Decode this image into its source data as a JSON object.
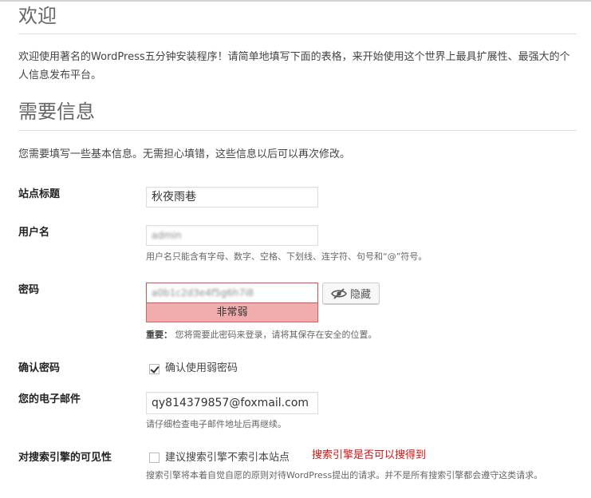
{
  "welcome": {
    "title": "欢迎",
    "text": "欢迎使用著名的WordPress五分钟安装程序！请简单地填写下面的表格，来开始使用这个世界上最具扩展性、最强大的个人信息发布平台。"
  },
  "info": {
    "title": "需要信息",
    "desc": "您需要填写一些基本信息。无需担心填错，这些信息以后可以再次修改。"
  },
  "fields": {
    "site_title": {
      "label": "站点标题",
      "value": "秋夜雨巷"
    },
    "username": {
      "label": "用户名",
      "value": "admin",
      "hint": "用户名只能含有字母、数字、空格、下划线、连字符、句号和“@”符号。"
    },
    "password": {
      "label": "密码",
      "value": "a0b1c2d3e4f5g6h7i8",
      "strength": "非常弱",
      "hide_label": "隐藏",
      "hint_bold": "重要：",
      "hint": "您将需要此密码来登录，请将其保存在安全的位置。"
    },
    "confirm": {
      "label": "确认密码",
      "checkbox_label": "确认使用弱密码",
      "checked": true
    },
    "email": {
      "label": "您的电子邮件",
      "value": "qy814379857@foxmail.com",
      "hint": "请仔细检查电子邮件地址后再继续。"
    },
    "search": {
      "label": "对搜索引擎的可见性",
      "checkbox_label": "建议搜索引擎不索引本站点",
      "checked": false,
      "annotation": "搜索引擎是否可以搜得到",
      "desc": "搜索引擎将本着自觉自愿的原则对待WordPress提出的请求。并不是所有搜索引擎都会遵守这类请求。"
    }
  },
  "colors": {
    "strength_bg": "#f1adad",
    "strength_border": "#e35b5b",
    "annotation": "#dd1111"
  },
  "icons": {
    "hide_button": "eye-slash-icon"
  }
}
